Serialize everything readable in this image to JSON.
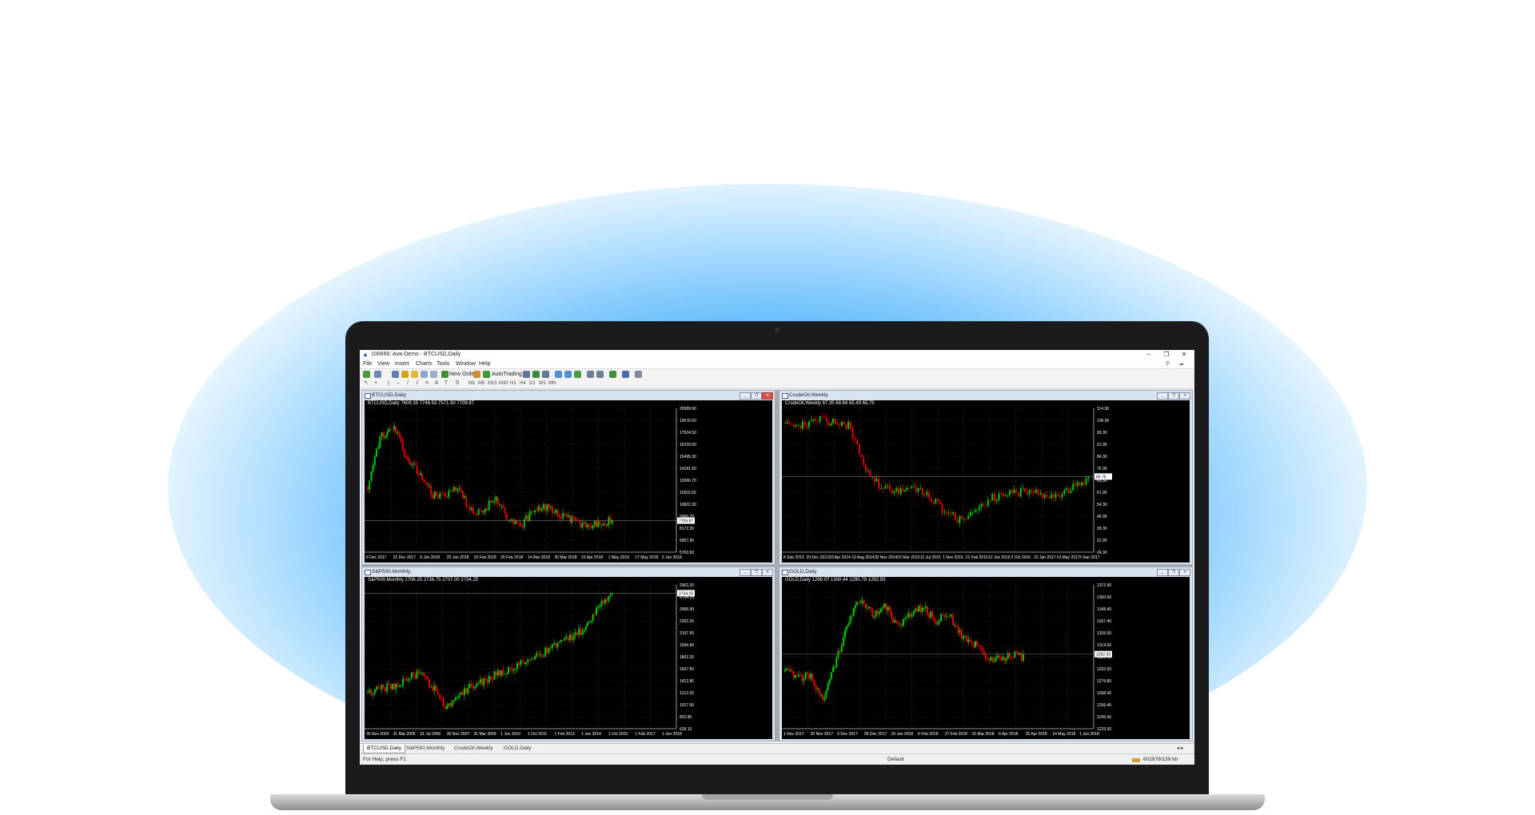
{
  "window": {
    "title": "100666: Ava-Demo - BTCUSD,Daily",
    "minimize": "–",
    "maximize": "❐",
    "close": "✕"
  },
  "menu": [
    "File",
    "View",
    "Insert",
    "Charts",
    "Tools",
    "Window",
    "Help"
  ],
  "toolbar": {
    "new_order": "New Order",
    "auto_trading": "AutoTrading"
  },
  "timeframes": [
    "M1",
    "M5",
    "M15",
    "M30",
    "H1",
    "H4",
    "D1",
    "W1",
    "MN"
  ],
  "charts": [
    {
      "tab": "BTCUSD,Daily",
      "info": "BTCUSD,Daily  7609.35 7748.53 7571.50 7709.87",
      "price_labels": [
        "20589.90",
        "19576.50",
        "17924.50",
        "16159.50",
        "15495.30",
        "14181.50",
        "13066.70",
        "11815.50",
        "10602.30",
        "9366.70",
        "8172.30",
        "6957.90",
        "5763.50"
      ],
      "current_price": "7709.87",
      "date_labels": [
        "6 Dec 2017",
        "22 Dec 2017",
        "9 Jan 2018",
        "25 Jan 2018",
        "10 Feb 2018",
        "26 Feb 2018",
        "14 Mar 2018",
        "30 Mar 2018",
        "15 Apr 2018",
        "1 May 2018",
        "17 May 2018",
        "2 Jun 2018"
      ],
      "active": true
    },
    {
      "tab": "CrudeOil,Weekly",
      "info": "CrudeOil,Weekly  67.35 68.64 65.49 65.75",
      "price_labels": [
        "114.30",
        "106.90",
        "99.30",
        "91.90",
        "84.30",
        "76.90",
        "69.30",
        "61.90",
        "54.30",
        "46.90",
        "39.30",
        "31.90",
        "24.30"
      ],
      "current_price": "65.75",
      "date_labels": [
        "8 Sep 2013",
        "29 Dec 2013",
        "20 Apr 2014",
        "10 Aug 2014",
        "30 Nov 2014",
        "22 Mar 2015",
        "12 Jul 2015",
        "1 Nov 2015",
        "21 Feb 2016",
        "12 Jun 2016",
        "2 Oct 2016",
        "22 Jan 2017",
        "14 May 2017",
        "3 Sep 2017"
      ],
      "active": false
    },
    {
      "tab": "S&P500,Monthly",
      "info": "S&P500,Monthly  2706.25 2736.75 2707.00 2734.25",
      "price_labels": [
        "2962.20",
        "2734.25",
        "2566.90",
        "2392.20",
        "2197.50",
        "1996.90",
        "1802.20",
        "1607.50",
        "1412.80",
        "1212.20",
        "1017.50",
        "822.80",
        "628.10"
      ],
      "current_price": "2734.25",
      "date_labels": [
        "30 Nov 2003",
        "31 Mar 2005",
        "31 Jul 2006",
        "30 Nov 2007",
        "31 Mar 2009",
        "1 Jun 2010",
        "1 Oct 2011",
        "1 Feb 2013",
        "1 Jun 2014",
        "1 Oct 2015",
        "1 Feb 2017",
        "1 Jun 2018"
      ],
      "active": false
    },
    {
      "tab": "GOLD,Daily",
      "info": "GOLD,Daily  1299.07 1300.44 1290.79 1292.93",
      "price_labels": [
        "1372.90",
        "1360.50",
        "1348.40",
        "1337.40",
        "1326.00",
        "1314.00",
        "1302.90",
        "1292.93",
        "1279.80",
        "1268.40",
        "1256.40",
        "1245.00",
        "1233.90"
      ],
      "current_price": "1292.93",
      "date_labels": [
        "1 Nov 2017",
        "20 Nov 2017",
        "6 Dec 2017",
        "26 Dec 2017",
        "19 Jan 2018",
        "6 Feb 2018",
        "27 Feb 2018",
        "15 Mar 2018",
        "6 Apr 2018",
        "25 Apr 2018",
        "14 May 2018",
        "1 Jun 2018"
      ],
      "active": false
    }
  ],
  "tabs": [
    "BTCUSD,Daily",
    "S&P500,Monthly",
    "CrudeOil,Weekly",
    "GOLD,Daily"
  ],
  "status": {
    "help": "For Help, press F1",
    "profile": "Default",
    "traffic": "602976/139 kb"
  }
}
